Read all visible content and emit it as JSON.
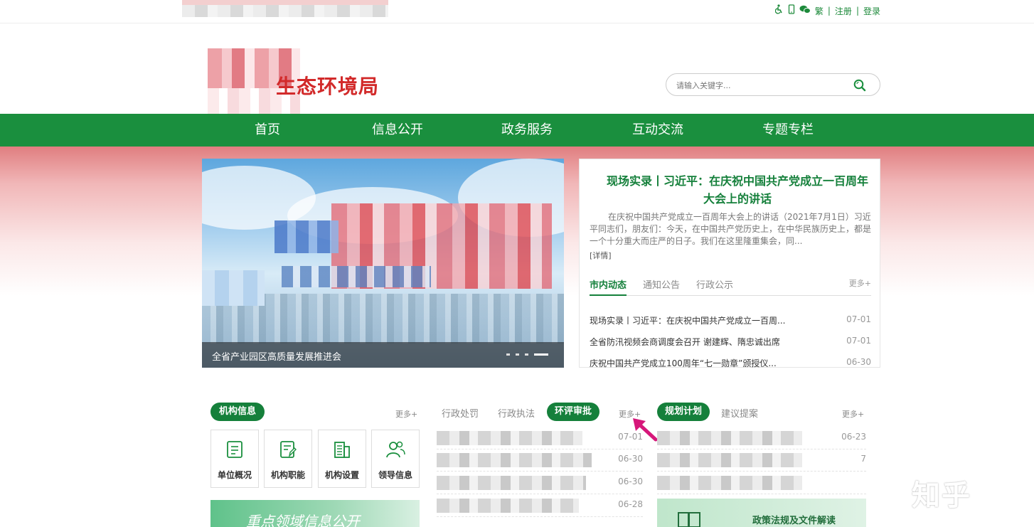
{
  "topbar": {
    "traditional": "繁",
    "register": "注册",
    "login": "登录",
    "separator": "|",
    "icons": [
      "accessibility-icon",
      "mobile-icon",
      "wechat-icon"
    ]
  },
  "header": {
    "logo_text": "生态环境局",
    "search_placeholder": "请输入关键字..."
  },
  "nav": {
    "items": [
      "首页",
      "信息公开",
      "政务服务",
      "互动交流",
      "专题专栏"
    ]
  },
  "banner": {
    "caption": "全省产业园区高质量发展推进会"
  },
  "news_card": {
    "headline": "现场实录丨习近平：在庆祝中国共产党成立一百周年大会上的讲话",
    "summary": "在庆祝中国共产党成立一百周年大会上的讲话（2021年7月1日）习近平同志们，朋友们：今天，在中国共产党历史上，在中华民族历史上，都是一个十分重大而庄严的日子。我们在这里隆重集会，同...",
    "detail": "[详情]",
    "tabs": [
      "市内动态",
      "通知公告",
      "行政公示"
    ],
    "more": "更多+",
    "items": [
      {
        "title": "现场实录丨习近平：在庆祝中国共产党成立一百周...",
        "date": "07-01"
      },
      {
        "title": "全省防汛视频会商调度会召开 谢建辉、隋忠诚出席",
        "date": "07-01"
      },
      {
        "title": "庆祝中国共产党成立100周年“七一勋章”颁授仪...",
        "date": "06-30"
      }
    ]
  },
  "org": {
    "title": "机构信息",
    "more": "更多+",
    "tiles": [
      "单位概况",
      "机构职能",
      "机构设置",
      "领导信息"
    ],
    "focus_banner": "重点领域信息公开"
  },
  "mid": {
    "tabs": [
      "行政处罚",
      "行政执法",
      "环评审批"
    ],
    "more": "更多+",
    "dates": [
      "07-01",
      "06-30",
      "06-30",
      "06-28"
    ]
  },
  "plan": {
    "tabs": [
      "规划计划",
      "建议提案"
    ],
    "more": "更多+",
    "dates": [
      "06-23",
      "7"
    ],
    "policy_banner": "政策法规及文件解读"
  },
  "watermark": {
    "text": "知乎"
  },
  "colors": {
    "brand_green": "#1a8f3e",
    "logo_red": "#d22a2a",
    "highlight_arrow": "#d6177a"
  }
}
